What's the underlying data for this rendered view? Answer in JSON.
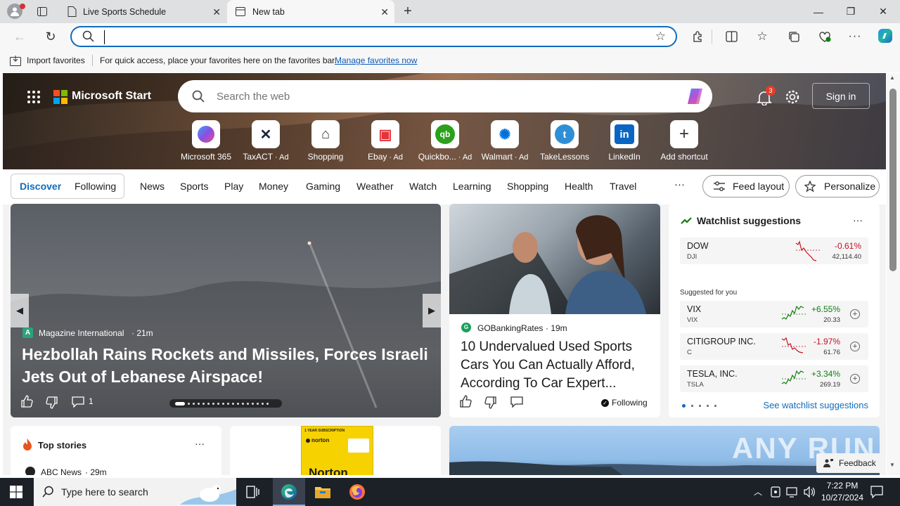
{
  "browser": {
    "tabs": [
      {
        "label": "Live Sports Schedule"
      },
      {
        "label": "New tab"
      }
    ],
    "address": {
      "value": "",
      "placeholder": ""
    },
    "favorites_bar": {
      "import_label": "Import favorites",
      "message": "For quick access, place your favorites here on the favorites bar.",
      "manage_link": "Manage favorites now"
    }
  },
  "msn": {
    "brand": "Microsoft Start",
    "search_placeholder": "Search the web",
    "notification_count": "3",
    "sign_in": "Sign in",
    "shortcuts": [
      {
        "label": "Microsoft 365",
        "icon": "m365-icon",
        "color": "#6b5be0"
      },
      {
        "label": "TaxACT",
        "ad": "· Ad",
        "icon": "taxact-icon",
        "color": "#1c2540"
      },
      {
        "label": "Shopping",
        "icon": "tag-icon",
        "color": "#333333"
      },
      {
        "label": "Ebay",
        "ad": "· Ad",
        "icon": "bag-icon",
        "color": "#e53238"
      },
      {
        "label": "Quickbo...",
        "ad": "· Ad",
        "icon": "qb-icon",
        "color": "#2ca01c"
      },
      {
        "label": "Walmart",
        "ad": "· Ad",
        "icon": "walmart-icon",
        "color": "#0071dc"
      },
      {
        "label": "TakeLessons",
        "icon": "takelessons-icon",
        "color": "#2f8fd6"
      },
      {
        "label": "LinkedIn",
        "icon": "linkedin-icon",
        "color": "#0a66c2"
      },
      {
        "label": "Add shortcut",
        "icon": "plus-icon",
        "color": "#333333"
      }
    ],
    "nav": {
      "discover": "Discover",
      "following": "Following",
      "items": [
        "News",
        "Sports",
        "Play",
        "Money",
        "Gaming",
        "Weather",
        "Watch",
        "Learning",
        "Shopping",
        "Health",
        "Travel"
      ],
      "more": "···",
      "feed_layout": "Feed layout",
      "personalize": "Personalize"
    },
    "hero_story": {
      "source": "Magazine International",
      "time": "· 21m",
      "title": "Hezbollah Rains Rockets and Missiles, Forces Israeli Jets Out of Lebanese Airspace!",
      "comments": "1"
    },
    "story2": {
      "source": "GOBankingRates",
      "time": "· 19m",
      "title": "10 Undervalued Used Sports Cars You Can Actually Afford, According To Car Expert...",
      "following": "Following"
    },
    "watchlist": {
      "title": "Watchlist suggestions",
      "more": "···",
      "main": {
        "name": "DOW",
        "symbol": "DJI",
        "change": "-0.61%",
        "price": "42,114.40",
        "color": "#c50f1f"
      },
      "suggested_label": "Suggested for you",
      "suggested": [
        {
          "name": "VIX",
          "symbol": "VIX",
          "change": "+6.55%",
          "price": "20.33",
          "color": "#107c10"
        },
        {
          "name": "CITIGROUP INC.",
          "symbol": "C",
          "change": "-1.97%",
          "price": "61.76",
          "color": "#c50f1f"
        },
        {
          "name": "TESLA, INC.",
          "symbol": "TSLA",
          "change": "+3.34%",
          "price": "269.19",
          "color": "#107c10"
        }
      ],
      "see_more": "See watchlist suggestions"
    },
    "top_stories": {
      "title": "Top stories",
      "more": "···",
      "first_source": "ABC News",
      "first_time": "· 29m"
    },
    "ad_product": {
      "subscription": "1 YEAR SUBSCRIPTION",
      "brand": "norton",
      "title": "Norton"
    },
    "feedback": "Feedback",
    "watermark": "ANY RUN"
  },
  "taskbar": {
    "search_placeholder": "Type here to search",
    "time": "7:22 PM",
    "date": "10/27/2024"
  }
}
